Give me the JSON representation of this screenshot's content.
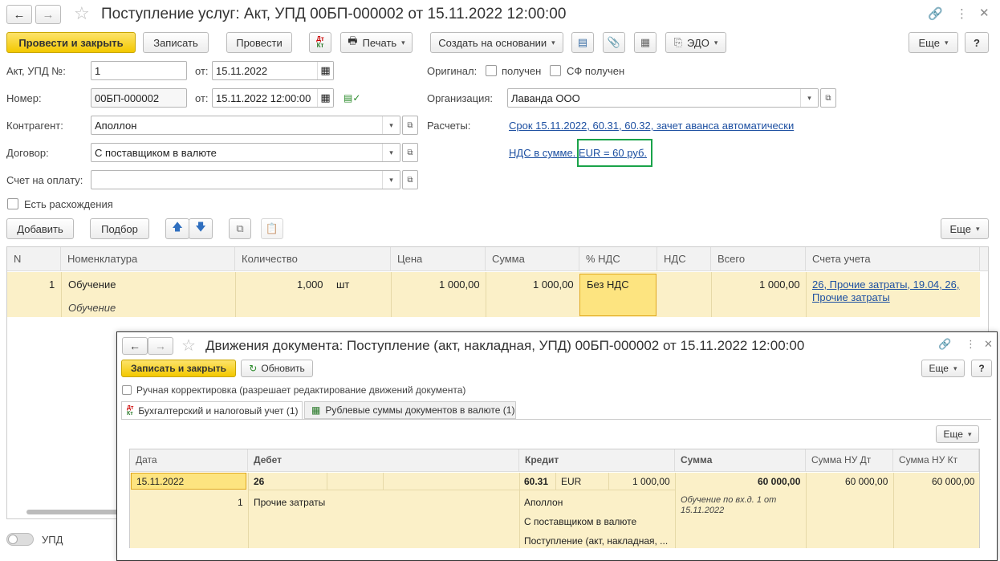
{
  "main": {
    "title": "Поступление услуг: Акт, УПД 00БП-000002 от 15.11.2022 12:00:00",
    "toolbar": {
      "post_close": "Провести и закрыть",
      "save": "Записать",
      "post": "Провести",
      "dtkt": "Дт Кт",
      "print": "Печать",
      "create_based": "Создать на основании",
      "edo": "ЭДО",
      "more": "Еще",
      "help": "?"
    },
    "form": {
      "act_label": "Акт, УПД №:",
      "act_value": "1",
      "from_label": "от:",
      "act_date": "15.11.2022",
      "number_label": "Номер:",
      "number_value": "00БП-000002",
      "from_label2": "от:",
      "number_date": "15.11.2022 12:00:00",
      "original_label": "Оригинал:",
      "received": "получен",
      "sf_received": "СФ получен",
      "org_label": "Организация:",
      "org_value": "Лаванда ООО",
      "contractor_label": "Контрагент:",
      "contractor_value": "Аполлон",
      "settlements_label": "Расчеты:",
      "settlements_link": "Срок 15.11.2022, 60.31, 60.32, зачет аванса автоматически",
      "vat_link_prefix": "НДС в сумме. ",
      "vat_link_highlight": "EUR = 60 руб.",
      "contract_label": "Договор:",
      "contract_value": "С поставщиком в валюте",
      "invoice_label": "Счет на оплату:",
      "invoice_value": "",
      "discrepancies": "Есть расхождения"
    },
    "table_toolbar": {
      "add": "Добавить",
      "pick": "Подбор",
      "more": "Еще"
    },
    "table": {
      "headers": [
        "N",
        "Номенклатура",
        "Количество",
        "Цена",
        "Сумма",
        "% НДС",
        "НДС",
        "Всего",
        "Счета учета"
      ],
      "rows": [
        {
          "n": "1",
          "item": "Обучение",
          "item_sub": "Обучение",
          "qty": "1,000",
          "unit": "шт",
          "price": "1 000,00",
          "sum": "1 000,00",
          "vat_rate": "Без НДС",
          "vat": "",
          "total": "1 000,00",
          "accounts_line1": "26, Прочие затраты, 19.04, 26,",
          "accounts_line2": "Прочие затраты"
        }
      ]
    },
    "footer_toggle": "УПД"
  },
  "modal": {
    "title": "Движения документа: Поступление (акт, накладная, УПД) 00БП-000002 от 15.11.2022 12:00:00",
    "save_close": "Записать и закрыть",
    "refresh": "Обновить",
    "more": "Еще",
    "help": "?",
    "manual_adjust": "Ручная корректировка (разрешает редактирование движений документа)",
    "tabs": [
      "Бухгалтерский и налоговый учет (1)",
      "Рублевые суммы документов в валюте (1)"
    ],
    "inner_more": "Еще",
    "headers": [
      "Дата",
      "Дебет",
      "Кредит",
      "Сумма",
      "Сумма НУ Дт",
      "Сумма НУ Кт"
    ],
    "row": {
      "date": "15.11.2022",
      "num": "1",
      "debit_account": "26",
      "debit_sub": "Прочие затраты",
      "credit_account": "60.31",
      "currency": "EUR",
      "currency_amount": "1 000,00",
      "credit_sub1": "Аполлон",
      "credit_sub2": "С поставщиком в валюте",
      "credit_sub3": "Поступление (акт, накладная, ...",
      "amount": "60 000,00",
      "amount_note": "Обучение по вх.д. 1 от 15.11.2022",
      "tax_dt": "60 000,00",
      "tax_kt": "60 000,00"
    }
  }
}
